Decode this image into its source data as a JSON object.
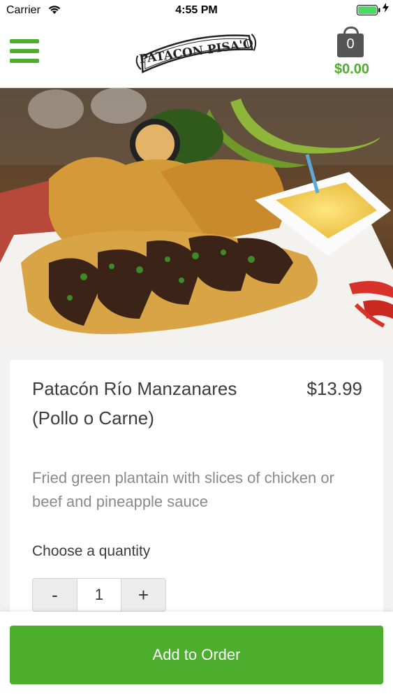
{
  "status_bar": {
    "carrier": "Carrier",
    "time": "4:55 PM",
    "wifi_icon": "wifi-icon",
    "battery_icon": "battery-icon"
  },
  "header": {
    "menu_icon": "hamburger-menu-icon",
    "logo_text": "PATACON PISA'O",
    "cart": {
      "count": "0",
      "total": "$0.00",
      "icon": "shopping-bag-icon"
    }
  },
  "item": {
    "name": "Patacón Río Manzanares (Pollo o Carne)",
    "price": "$13.99",
    "description": "Fried green plantain with slices of chicken or beef and pineapple sauce"
  },
  "quantity": {
    "label": "Choose a quantity",
    "minus": "-",
    "value": "1",
    "plus": "+"
  },
  "footer": {
    "add_label": "Add to Order"
  },
  "colors": {
    "accent": "#4cae2c",
    "text": "#3c3c3c",
    "muted": "#8a8a8a"
  }
}
